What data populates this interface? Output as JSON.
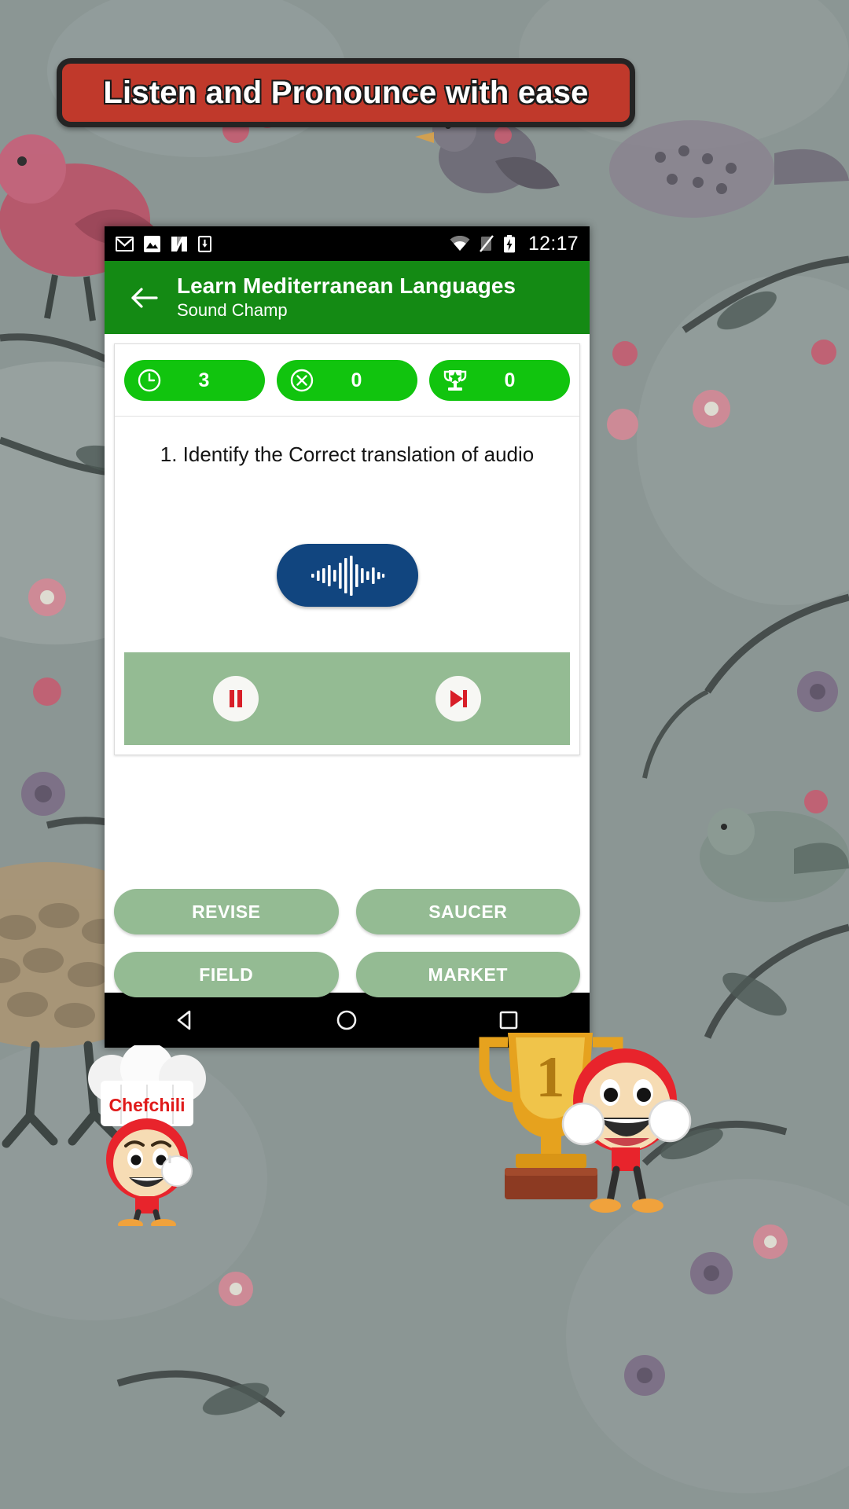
{
  "promo": {
    "text": "Listen and Pronounce with ease",
    "bg_color": "#c0392b",
    "border_color": "#242424",
    "text_color": "#ffffff"
  },
  "status_bar": {
    "time": "12:17",
    "left_icons": [
      "gmail-icon",
      "photos-icon",
      "news-icon",
      "download-icon"
    ],
    "right_icons": [
      "wifi-icon",
      "signal-off-icon",
      "battery-charging-icon"
    ],
    "bg_color": "#000000"
  },
  "app_bar": {
    "back_icon": "back-arrow-icon",
    "title": "Learn Mediterranean Languages",
    "subtitle": "Sound Champ",
    "bg_color": "#148a14"
  },
  "stats": [
    {
      "icon": "clock-icon",
      "name": "timer",
      "value": "3"
    },
    {
      "icon": "x-circle-icon",
      "name": "wrong",
      "value": "0"
    },
    {
      "icon": "trophy-icon",
      "name": "score",
      "value": "0"
    }
  ],
  "stat_pill_color": "#11c40e",
  "question": {
    "text": "1. Identify the Correct translation of  audio"
  },
  "audio": {
    "button_icon": "audio-waveform-icon",
    "button_color": "#11457f"
  },
  "playback": {
    "bar_color": "#94bb93",
    "pause_icon": "pause-icon",
    "next_icon": "skip-next-icon",
    "control_color": "#d81e28"
  },
  "answers": [
    {
      "label": "REVISE"
    },
    {
      "label": "SAUCER"
    },
    {
      "label": "FIELD"
    },
    {
      "label": "MARKET"
    }
  ],
  "answer_color": "#94bb93",
  "nav_bar": {
    "back_icon": "nav-back-icon",
    "home_icon": "nav-home-icon",
    "recents_icon": "nav-recents-icon"
  },
  "mascots": {
    "chef_label": "Chefchili",
    "chef_label_color": "#e01b1b",
    "trophy_number": "1"
  }
}
